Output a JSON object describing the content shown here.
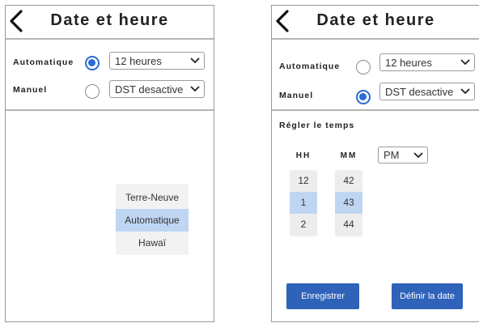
{
  "left": {
    "title": "Date et heure",
    "auto_label": "Automatique",
    "manual_label": "Manuel",
    "auto_select_value": "12 heures",
    "manual_select_value": "DST desactive",
    "auto_selected": true,
    "dropdown_items": [
      "Terre-Neuve",
      "Automatique",
      "Hawaï"
    ],
    "dropdown_selected": "Automatique"
  },
  "right": {
    "title": "Date et heure",
    "auto_label": "Automatique",
    "manual_label": "Manuel",
    "auto_select_value": "12 heures",
    "manual_select_value": "DST desactive",
    "manual_selected": true,
    "set_time_label": "Régler le temps",
    "hh_label": "HH",
    "mm_label": "MM",
    "hours": [
      "12",
      "1",
      "2"
    ],
    "minutes": [
      "42",
      "43",
      "44"
    ],
    "selected_hour": "1",
    "selected_minute": "43",
    "ampm_value": "PM",
    "save_button": "Enregistrer",
    "set_date_button": "Définir la date"
  },
  "colors": {
    "accent": "#2a6bd6",
    "button": "#2f63b9",
    "highlight": "#bfd6f3"
  },
  "icons": {
    "back": "chevron-left-icon",
    "dropdown": "chevron-down-icon"
  }
}
